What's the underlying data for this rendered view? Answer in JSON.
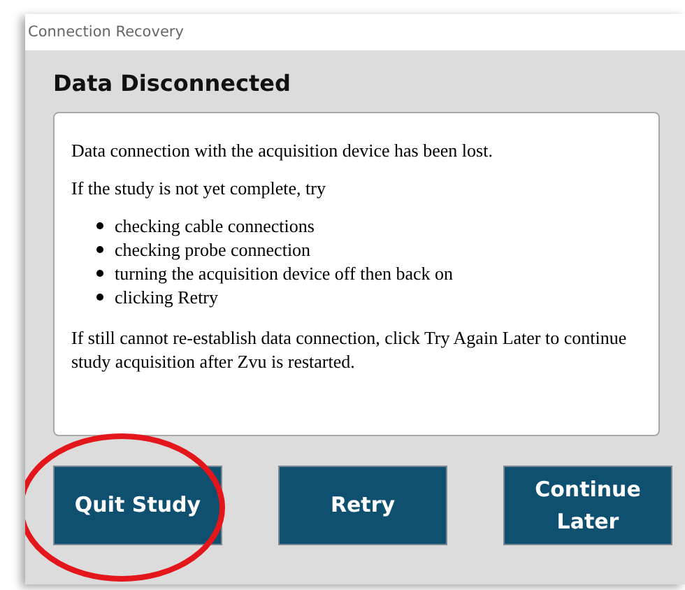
{
  "window": {
    "title": "Connection Recovery"
  },
  "heading": "Data Disconnected",
  "message": {
    "intro": "Data connection with the acquisition device has been lost.",
    "lead": "If the study is not yet complete, try",
    "steps": [
      "checking cable connections",
      "checking probe connection",
      "turning the acquisition device off then back on",
      "clicking Retry"
    ],
    "closing": "If still cannot re-establish data connection, click Try Again Later to continue study acquisition after Zvu is restarted."
  },
  "buttons": [
    {
      "label": "Quit Study",
      "highlighted": true
    },
    {
      "label": "Retry",
      "highlighted": false
    },
    {
      "label": "Continue Later",
      "highlighted": false
    }
  ]
}
